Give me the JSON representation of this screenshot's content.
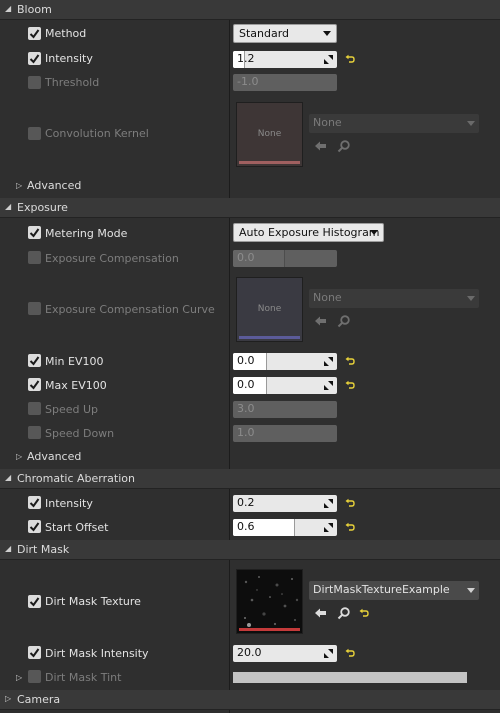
{
  "sections": {
    "bloom": "Bloom",
    "exposure": "Exposure",
    "chromatic": "Chromatic Aberration",
    "dirt": "Dirt Mask",
    "camera": "Camera"
  },
  "bloom": {
    "method_label": "Method",
    "method_value": "Standard",
    "intensity_label": "Intensity",
    "intensity_value": "1.2",
    "threshold_label": "Threshold",
    "threshold_value": "-1.0",
    "kernel_label": "Convolution Kernel",
    "kernel_thumb": "None",
    "kernel_asset": "None",
    "advanced_label": "Advanced"
  },
  "exposure": {
    "metering_label": "Metering Mode",
    "metering_value": "Auto Exposure Histogram",
    "comp_label": "Exposure Compensation",
    "comp_value": "0.0",
    "curve_label": "Exposure Compensation Curve",
    "curve_thumb": "None",
    "curve_asset": "None",
    "min_label": "Min EV100",
    "min_value": "0.0",
    "max_label": "Max EV100",
    "max_value": "0.0",
    "speedup_label": "Speed Up",
    "speedup_value": "3.0",
    "speeddown_label": "Speed Down",
    "speeddown_value": "1.0",
    "advanced_label": "Advanced"
  },
  "chromatic": {
    "intensity_label": "Intensity",
    "intensity_value": "0.2",
    "offset_label": "Start Offset",
    "offset_value": "0.6"
  },
  "dirt": {
    "texture_label": "Dirt Mask Texture",
    "texture_asset": "DirtMaskTextureExample",
    "intensity_label": "Dirt Mask Intensity",
    "intensity_value": "20.0",
    "tint_label": "Dirt Mask Tint"
  },
  "levels": {
    "bloom_intensity_fill": 0.12,
    "threshold_fill": 0.0,
    "comp_fill": 0.5,
    "min_fill": 0.33,
    "max_fill": 0.33,
    "speedup_fill": 0.0,
    "speeddown_fill": 0.0,
    "chroma_intensity_fill": 0.0,
    "chroma_offset_fill": 0.6,
    "dirt_intensity_fill": 0.0
  },
  "colors": {
    "background": "#2f2f2f",
    "category": "#393939",
    "reset_arrow": "#e8d23a",
    "kernel_bar": "#a06060",
    "curve_bar": "#5b5b9a",
    "texture_bar": "#c33a3a"
  },
  "icons": [
    "checkbox-check-icon",
    "caret-down-icon",
    "drag-handle-icon",
    "reset-arrow-icon",
    "use-selected-arrow-icon",
    "browse-search-icon",
    "triangle-right-icon",
    "triangle-down-icon"
  ]
}
